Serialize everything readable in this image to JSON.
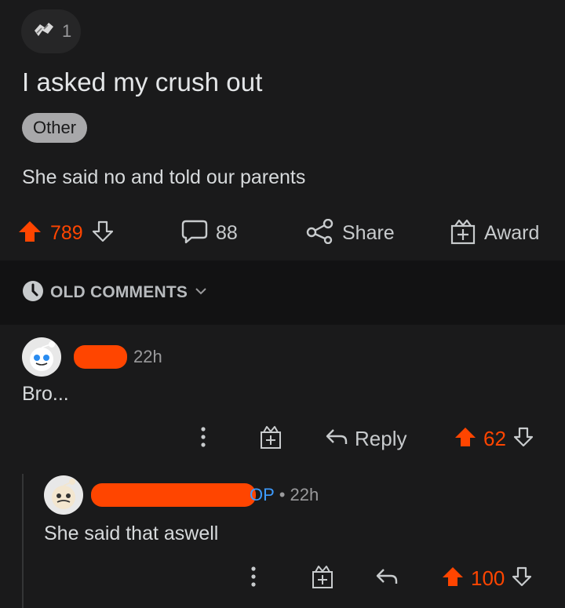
{
  "post": {
    "award_count": "1",
    "title": "I asked my crush out",
    "flair": "Other",
    "body": "She said no and told our parents",
    "votes": "789",
    "comments_count": "88",
    "share_label": "Share",
    "award_label": "Award"
  },
  "sort": {
    "label": "OLD COMMENTS"
  },
  "comments": [
    {
      "time": "22h",
      "body": "Bro...",
      "reply_label": "Reply",
      "votes": "62"
    },
    {
      "op_badge": "OP",
      "separator": "•",
      "time": "22h",
      "body": "She said that aswell",
      "votes": "100"
    }
  ],
  "colors": {
    "background": "#1a1a1b",
    "sort_background": "#121213",
    "upvote": "#ff4500",
    "op": "#3d9bff",
    "flair_bg": "#a8a8aa"
  }
}
